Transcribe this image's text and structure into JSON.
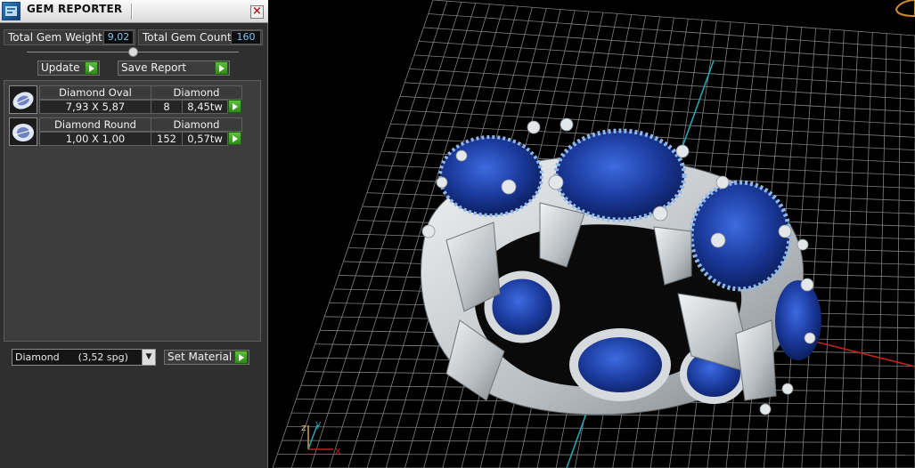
{
  "window": {
    "title": "GEM REPORTER",
    "close_glyph": "×"
  },
  "summary": {
    "total_weight_label": "Total Gem Weight",
    "total_weight_value": "9,02",
    "total_count_label": "Total Gem Count",
    "total_count_value": "160"
  },
  "actions": {
    "update_label": "Update",
    "save_report_label": "Save Report"
  },
  "gems": [
    {
      "shape": "Diamond Oval",
      "material": "Diamond",
      "size": "7,93 X 5,87",
      "count": "8",
      "weight": "8,45tw",
      "icon": "oval-gem-icon"
    },
    {
      "shape": "Diamond Round",
      "material": "Diamond",
      "size": "1,00 X 1,00",
      "count": "152",
      "weight": "0,57tw",
      "icon": "round-gem-icon"
    }
  ],
  "material": {
    "selected": "Diamond      (3,52 spg)",
    "set_label": "Set Material"
  },
  "viewport": {
    "axis_labels": {
      "x": "x",
      "y": "y",
      "z": "z"
    },
    "colors": {
      "gem_blue": "#1a3a9a",
      "metal": "#cfd3d6",
      "grid": "#8a8a8a",
      "x_axis": "#c02020",
      "y_axis": "#2aa3b0"
    }
  }
}
